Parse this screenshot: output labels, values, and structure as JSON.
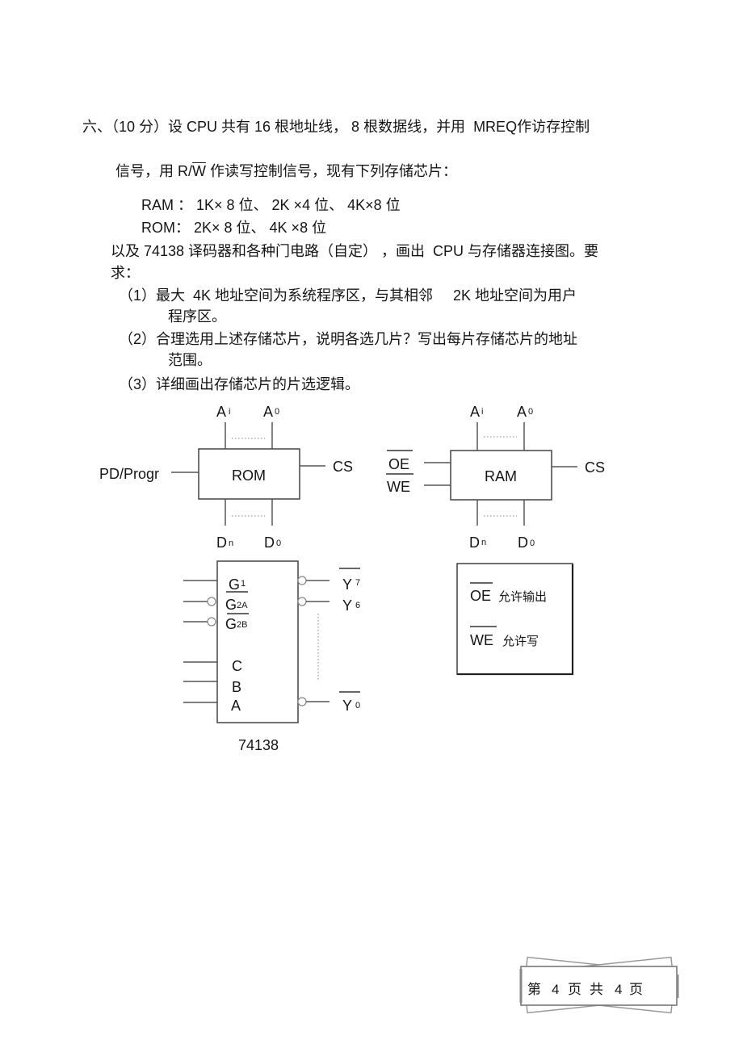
{
  "question": {
    "line1": "六、（10 分）设 CPU 共有 16 根地址线， 8 根数据线，并用  MREQ作访存控制",
    "line2": {
      "prefix": "信号，用 ",
      "signal_r": "R/",
      "signal_w": "W",
      "suffix": " 作读写控制信号，现有下列存储芯片："
    },
    "chips_available": {
      "ram": "RAM ： 1K× 8 位、 2K ×4 位、 4K×8 位",
      "rom": "ROM： 2K× 8 位、 4K ×8 位"
    },
    "line_decoder": "以及 74138 译码器和各种门电路（自定） ，画出  CPU 与存储器连接图。要",
    "line_decoder_cont": "求：",
    "requirements": [
      {
        "num": "（1）",
        "text": "最大  4K 地址空间为系统程序区，与其相邻     2K 地址空间为用户",
        "cont": "程序区。"
      },
      {
        "num": "（2）",
        "text": "合理选用上述存储芯片，说明各选几片？写出每片存储芯片的地址",
        "cont": "范围。"
      },
      {
        "num": "（3）",
        "text": "详细画出存储芯片的片选逻辑。"
      }
    ]
  },
  "rom_chip": {
    "label": "ROM",
    "addr_high": {
      "name": "A",
      "sub": "i"
    },
    "addr_low": {
      "name": "A",
      "sub": "0"
    },
    "data_high": {
      "name": "D",
      "sub": "n"
    },
    "data_low": {
      "name": "D",
      "sub": "0"
    },
    "left_signal": "PD/Progr",
    "right_signal": "CS"
  },
  "ram_chip": {
    "label": "RAM",
    "addr_high": {
      "name": "A",
      "sub": "i"
    },
    "addr_low": {
      "name": "A",
      "sub": "0"
    },
    "data_high": {
      "name": "D",
      "sub": "n"
    },
    "data_low": {
      "name": "D",
      "sub": "0"
    },
    "left_signals": [
      "OE",
      "WE"
    ],
    "right_signal": "CS"
  },
  "decoder": {
    "label": "74138",
    "enables": [
      {
        "name": "G",
        "sub": "1"
      },
      {
        "name": "G",
        "sub": "2A"
      },
      {
        "name": "G",
        "sub": "2B"
      }
    ],
    "selects": [
      "C",
      "B",
      "A"
    ],
    "outputs": [
      {
        "name": "Y",
        "sub": "7"
      },
      {
        "name": "Y",
        "sub": "6"
      },
      {
        "name": "Y",
        "sub": "0"
      }
    ]
  },
  "legend": {
    "items": [
      {
        "signal": "OE",
        "desc": "允许输出"
      },
      {
        "signal": "WE",
        "desc": "允许写"
      }
    ]
  },
  "footer": {
    "prefix": "第",
    "current_page": "4",
    "page_unit": "页",
    "total_label": "共",
    "total_pages": "4",
    "page_unit_2": "页"
  }
}
